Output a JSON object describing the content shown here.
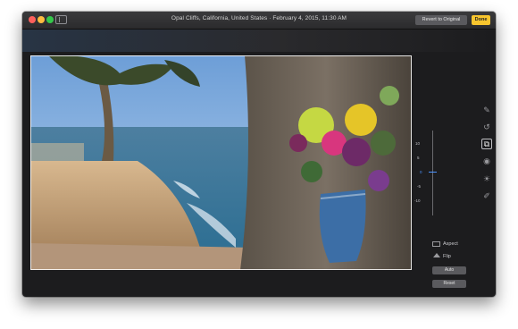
{
  "window": {
    "title": "Opal Cliffs, California, United States  ·  February 4, 2015, 11:30 AM",
    "revert_label": "Revert to Original",
    "done_label": "Done"
  },
  "crop_panel": {
    "dial_ticks": [
      "10",
      "5",
      "0",
      "-5",
      "-10"
    ],
    "aspect_label": "Aspect",
    "flip_label": "Flip",
    "auto_label": "Auto",
    "reset_label": "Reset"
  },
  "tools": [
    {
      "name": "enhance-icon",
      "glyph": "✎"
    },
    {
      "name": "rotate-icon",
      "glyph": "↺"
    },
    {
      "name": "crop-icon",
      "glyph": "⧉"
    },
    {
      "name": "filters-icon",
      "glyph": "◉"
    },
    {
      "name": "adjust-icon",
      "glyph": "☀"
    },
    {
      "name": "retouch-icon",
      "glyph": "✐"
    }
  ],
  "colors": {
    "done_accent": "#f7c52e",
    "window_bg": "#1c1c1e"
  }
}
